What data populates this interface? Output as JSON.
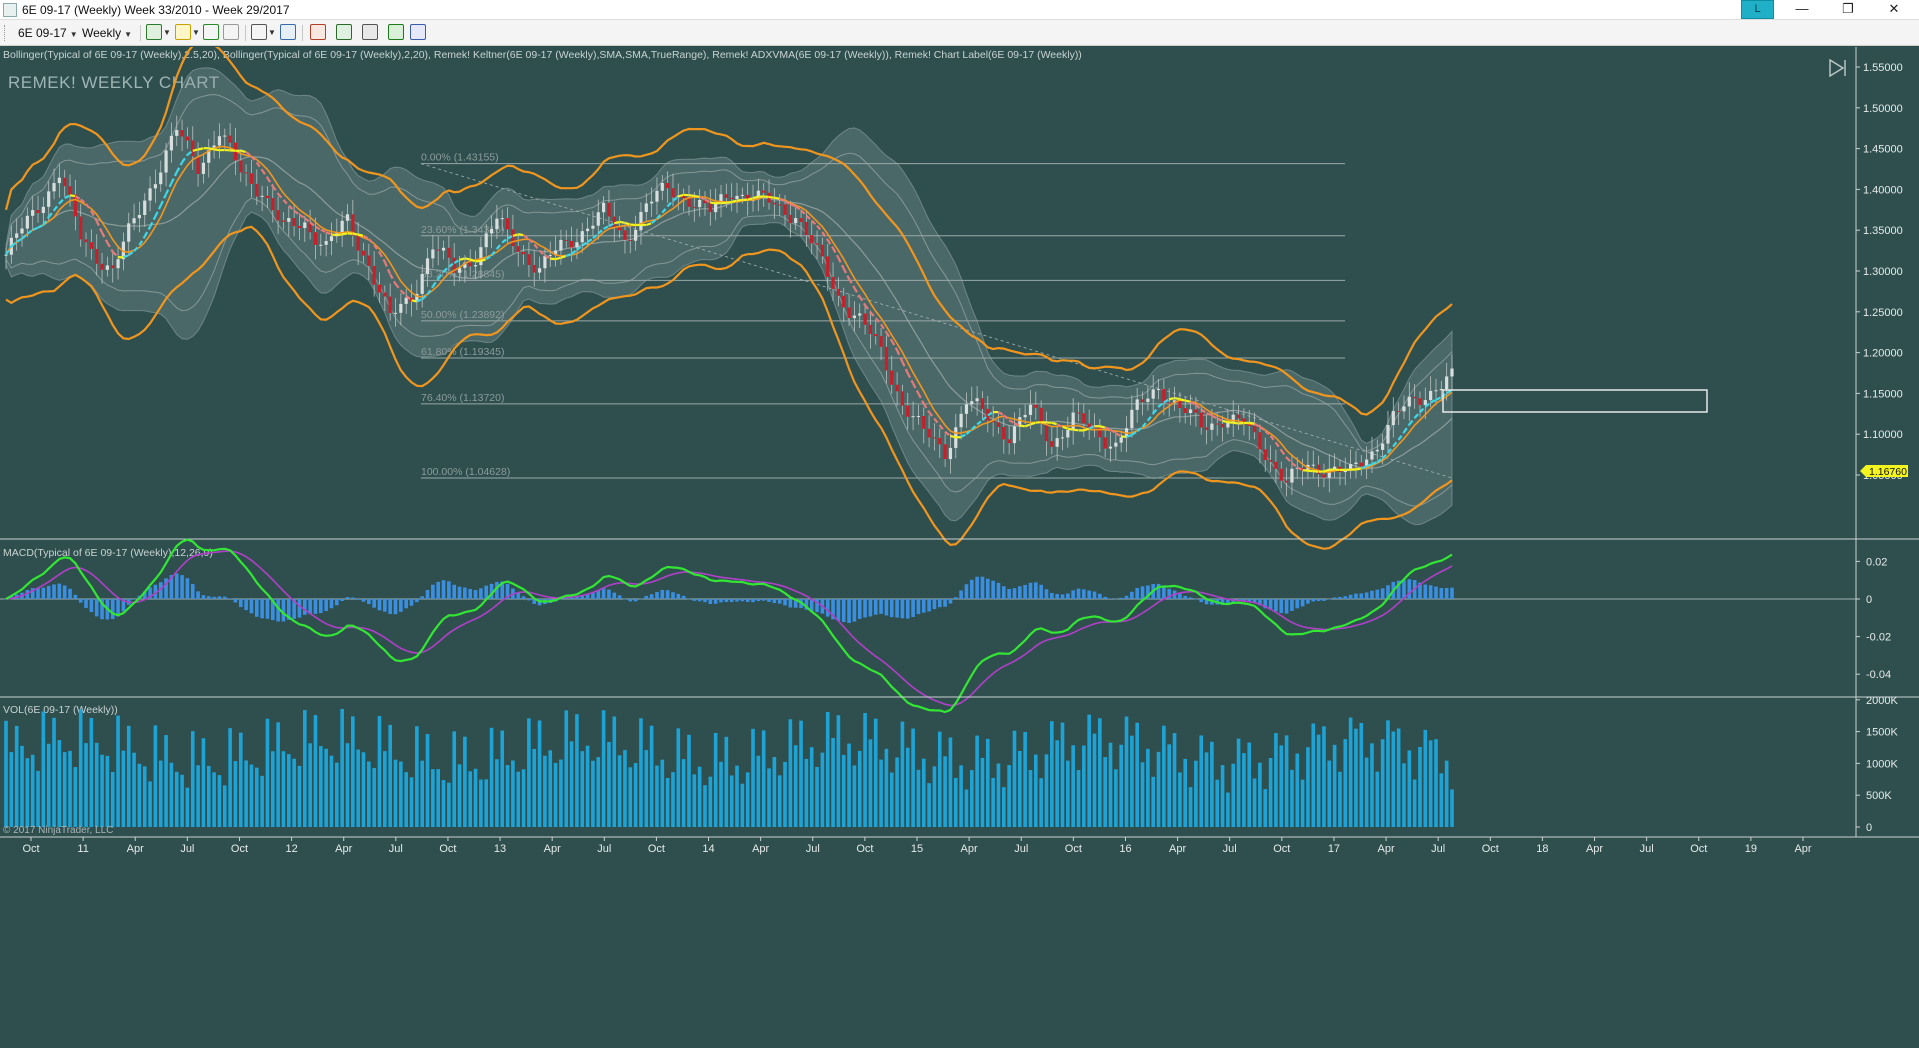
{
  "window": {
    "title": "6E 09-17 (Weekly)  Week 33/2010 - Week 29/2017",
    "badge": "L",
    "minimize": "—",
    "restore": "❐",
    "close": "✕"
  },
  "toolbar": {
    "instrument": "6E 09-17",
    "interval": "Weekly",
    "icons": [
      "bar-style-icon",
      "draw-pencil-icon",
      "crosshair-icon",
      "hand-icon",
      "pointer-icon",
      "zoom-icon",
      "properties-icon",
      "indicators-icon",
      "strategies-icon",
      "dollar-icon",
      "data-box-icon"
    ]
  },
  "price_panel": {
    "indicators_label": "Bollinger(Typical of 6E 09-17 (Weekly),2.5,20), Bollinger(Typical of 6E 09-17 (Weekly),2,20), Remek! Keltner(6E 09-17 (Weekly),SMA,SMA,TrueRange), Remek! ADXVMA(6E 09-17 (Weekly)), Remek! Chart Label(6E 09-17 (Weekly))",
    "watermark": "REMEK! WEEKLY CHART",
    "last_price": "1.16760",
    "y_ticks": [
      "1.55000",
      "1.50000",
      "1.45000",
      "1.40000",
      "1.35000",
      "1.30000",
      "1.25000",
      "1.20000",
      "1.15000",
      "1.10000",
      "1.05000"
    ],
    "y_values": [
      1.55,
      1.5,
      1.45,
      1.4,
      1.35,
      1.3,
      1.25,
      1.2,
      1.15,
      1.1,
      1.05
    ],
    "fibonacci": [
      {
        "label": "0.00% (1.43155)",
        "value": 1.43155
      },
      {
        "label": "23.60% (1.34316)",
        "value": 1.34316
      },
      {
        "label": "38.20% (1.28845)",
        "value": 1.28845
      },
      {
        "label": "50.00% (1.23892)",
        "value": 1.23892
      },
      {
        "label": "61.80% (1.19345)",
        "value": 1.19345
      },
      {
        "label": "76.40% (1.13720)",
        "value": 1.1372
      },
      {
        "label": "100.00% (1.04628)",
        "value": 1.04628
      }
    ],
    "price_path": [
      [
        0,
        1.32
      ],
      [
        6,
        1.38
      ],
      [
        10,
        1.42
      ],
      [
        14,
        1.34
      ],
      [
        20,
        1.3
      ],
      [
        26,
        1.39
      ],
      [
        32,
        1.47
      ],
      [
        36,
        1.43
      ],
      [
        40,
        1.47
      ],
      [
        44,
        1.42
      ],
      [
        48,
        1.4
      ],
      [
        52,
        1.35
      ],
      [
        56,
        1.36
      ],
      [
        60,
        1.33
      ],
      [
        64,
        1.36
      ],
      [
        68,
        1.31
      ],
      [
        72,
        1.24
      ],
      [
        76,
        1.27
      ],
      [
        80,
        1.33
      ],
      [
        84,
        1.3
      ],
      [
        88,
        1.32
      ],
      [
        92,
        1.36
      ],
      [
        96,
        1.33
      ],
      [
        100,
        1.3
      ],
      [
        104,
        1.33
      ],
      [
        108,
        1.35
      ],
      [
        112,
        1.37
      ],
      [
        116,
        1.34
      ],
      [
        120,
        1.38
      ],
      [
        124,
        1.4
      ],
      [
        128,
        1.39
      ],
      [
        132,
        1.37
      ],
      [
        136,
        1.4
      ],
      [
        140,
        1.39
      ],
      [
        144,
        1.38
      ],
      [
        148,
        1.37
      ],
      [
        152,
        1.32
      ],
      [
        156,
        1.27
      ],
      [
        160,
        1.24
      ],
      [
        164,
        1.2
      ],
      [
        168,
        1.14
      ],
      [
        172,
        1.1
      ],
      [
        176,
        1.08
      ],
      [
        180,
        1.14
      ],
      [
        184,
        1.12
      ],
      [
        188,
        1.1
      ],
      [
        192,
        1.13
      ],
      [
        196,
        1.09
      ],
      [
        200,
        1.12
      ],
      [
        204,
        1.1
      ],
      [
        208,
        1.09
      ],
      [
        212,
        1.13
      ],
      [
        216,
        1.16
      ],
      [
        220,
        1.13
      ],
      [
        224,
        1.11
      ],
      [
        228,
        1.12
      ],
      [
        232,
        1.11
      ],
      [
        236,
        1.08
      ],
      [
        240,
        1.04
      ],
      [
        244,
        1.06
      ],
      [
        248,
        1.06
      ],
      [
        252,
        1.05
      ],
      [
        256,
        1.08
      ],
      [
        260,
        1.12
      ],
      [
        264,
        1.14
      ],
      [
        268,
        1.16
      ],
      [
        271,
        1.168
      ]
    ]
  },
  "macd_panel": {
    "label": "MACD(Typical of 6E 09-17 (Weekly),12,26,9)",
    "y_ticks": [
      "0.02",
      "0",
      "-0.02",
      "-0.04"
    ],
    "y_values": [
      0.02,
      0,
      -0.02,
      -0.04
    ]
  },
  "volume_panel": {
    "label": "VOL(6E 09-17 (Weekly))",
    "y_ticks": [
      "2000K",
      "1500K",
      "1000K",
      "500K",
      "0"
    ],
    "y_values": [
      2000,
      1500,
      1000,
      500,
      0
    ]
  },
  "x_axis": {
    "labels": [
      "Oct",
      "11",
      "Apr",
      "Jul",
      "Oct",
      "12",
      "Apr",
      "Jul",
      "Oct",
      "13",
      "Apr",
      "Jul",
      "Oct",
      "14",
      "Apr",
      "Jul",
      "Oct",
      "15",
      "Apr",
      "Jul",
      "Oct",
      "16",
      "Apr",
      "Jul",
      "Oct",
      "17",
      "Apr",
      "Jul",
      "Oct",
      "18",
      "Apr",
      "Jul",
      "Oct",
      "19",
      "Apr"
    ]
  },
  "copyright": "© 2017 NinjaTrader, LLC",
  "colors": {
    "background": "#2f4f4f",
    "band_fill": "#8a9e9e",
    "orange": "#f0961e",
    "adxvma_up": "#3ed8e8",
    "adxvma_flat": "#f2f21e",
    "adxvma_down": "#e87a7a",
    "macd": "#33e633",
    "signal": "#b040c8",
    "hist": "#3b8fe0",
    "volume": "#1ea3d6",
    "price_tag": "#f4f41e"
  }
}
